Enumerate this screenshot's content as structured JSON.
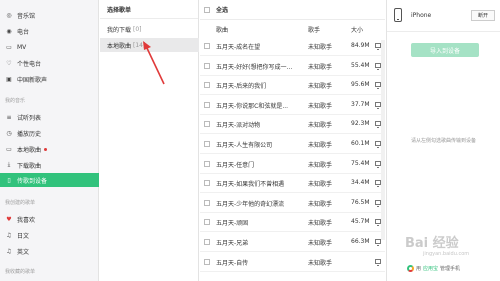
{
  "sidebar": {
    "items_top": [
      {
        "icon": "music-hall-icon",
        "label": "音乐馆"
      },
      {
        "icon": "radio-icon",
        "label": "电台"
      },
      {
        "icon": "mv-icon",
        "label": "MV"
      },
      {
        "icon": "personal-fm-icon",
        "label": "个性电台"
      },
      {
        "icon": "china-voice-icon",
        "label": "中国新歌声"
      }
    ],
    "section_my_music": "我的音乐",
    "items_my": [
      {
        "icon": "audition-list-icon",
        "label": "试听列表"
      },
      {
        "icon": "history-icon",
        "label": "播放历史"
      },
      {
        "icon": "local-songs-icon",
        "label": "本地歌曲"
      },
      {
        "icon": "download-icon",
        "label": "下载歌曲"
      },
      {
        "icon": "phone-icon",
        "label": "传歌到设备"
      }
    ],
    "section_created": "我创建的歌单",
    "items_created": [
      {
        "icon": "heart-icon",
        "label": "我喜欢"
      },
      {
        "icon": "note-icon",
        "label": "日文"
      },
      {
        "icon": "note-icon",
        "label": "英文"
      }
    ],
    "section_collected": "我收藏的歌单"
  },
  "playlist_column": {
    "header": "选择歌单",
    "items": [
      {
        "label": "我的下载",
        "count": "[0]"
      },
      {
        "label": "本地歌曲",
        "count": "[14]"
      }
    ]
  },
  "song_list": {
    "select_all": "全选",
    "columns": {
      "title": "歌曲",
      "artist": "歌手",
      "size": "大小"
    },
    "rows": [
      {
        "title": "五月天-成名在望",
        "artist": "未知歌手",
        "size": "84.9M"
      },
      {
        "title": "五月天-好好(想把你写成一...",
        "artist": "未知歌手",
        "size": "55.4M"
      },
      {
        "title": "五月天-后来的我们",
        "artist": "未知歌手",
        "size": "95.6M"
      },
      {
        "title": "五月天-你说那C和弦就是...",
        "artist": "未知歌手",
        "size": "37.7M"
      },
      {
        "title": "五月天-派对动物",
        "artist": "未知歌手",
        "size": "92.3M"
      },
      {
        "title": "五月天-人生有限公司",
        "artist": "未知歌手",
        "size": "60.1M"
      },
      {
        "title": "五月天-任意门",
        "artist": "未知歌手",
        "size": "75.4M"
      },
      {
        "title": "五月天-如果我们不曾相遇",
        "artist": "未知歌手",
        "size": "34.4M"
      },
      {
        "title": "五月天-少年他的奇幻漂流",
        "artist": "未知歌手",
        "size": "76.5M"
      },
      {
        "title": "五月天-顽固",
        "artist": "未知歌手",
        "size": "45.7M"
      },
      {
        "title": "五月天-兄弟",
        "artist": "未知歌手",
        "size": "66.3M"
      },
      {
        "title": "五月天-自传",
        "artist": "未知歌手",
        "size": ""
      }
    ]
  },
  "device": {
    "name": "iPhone",
    "disconnect_label": "断开",
    "import_label": "导入到设备",
    "hint": "请从左侧勾选歌曲传输到设备",
    "brand_prefix": "用",
    "brand_app": "应用宝",
    "brand_suffix": "管理手机"
  },
  "watermark": {
    "text": "Bai 经验",
    "sub": "jingyan.baidu.com"
  },
  "colors": {
    "accent": "#31c27c",
    "import_disabled": "#a5e2c5",
    "dot": "#e03a3a",
    "arrow": "#e03a3a"
  }
}
